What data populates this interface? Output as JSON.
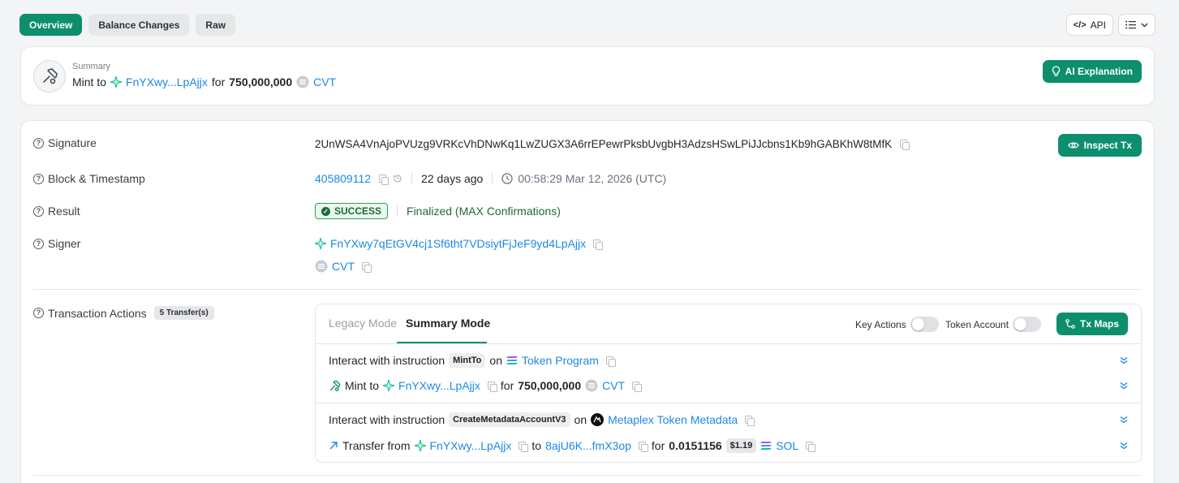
{
  "tabs": [
    {
      "label": "Overview"
    },
    {
      "label": "Balance Changes"
    },
    {
      "label": "Raw"
    }
  ],
  "toolbar": {
    "api_label": "API"
  },
  "summary": {
    "label": "Summary",
    "action": "Mint to",
    "account": "FnYXwy...LpAjjx",
    "for_word": "for",
    "amount": "750,000,000",
    "token": "CVT",
    "ai_button": "AI Explanation"
  },
  "details": {
    "signature": {
      "label": "Signature",
      "value": "2UnWSA4VnAjoPVUzg9VRKcVhDNwKq1LwZUGX3A6rrEPewrPksbUvgbH3AdzsHSwLPiJJcbns1Kb9hGABKhW8tMfK"
    },
    "inspect_button": "Inspect Tx",
    "block": {
      "label": "Block & Timestamp",
      "number": "405809112",
      "age": "22 days ago",
      "timestamp": "00:58:29 Mar 12, 2026 (UTC)"
    },
    "result": {
      "label": "Result",
      "status": "SUCCESS",
      "finality": "Finalized (MAX Confirmations)"
    },
    "signer": {
      "label": "Signer",
      "address": "FnYXwy7qEtGV4cj1Sf6tht7VDsiytFjJeF9yd4LpAjjx",
      "token": "CVT"
    },
    "actions": {
      "label": "Transaction Actions",
      "count_badge": "5 Transfer(s)",
      "legacy_mode": "Legacy Mode",
      "summary_mode": "Summary Mode",
      "key_actions": "Key Actions",
      "token_account": "Token Account",
      "tx_maps": "Tx Maps",
      "items": [
        {
          "prefix": "Interact with instruction",
          "instruction": "MintTo",
          "on": "on",
          "program": "Token Program",
          "sub_action": "Mint to",
          "sub_account": "FnYXwy...LpAjjx",
          "sub_for": "for",
          "sub_amount": "750,000,000",
          "sub_token": "CVT"
        },
        {
          "prefix": "Interact with instruction",
          "instruction": "CreateMetadataAccountV3",
          "on": "on",
          "program": "Metaplex Token Metadata",
          "sub_action": "Transfer from",
          "sub_from": "FnYXwy...LpAjjx",
          "sub_to_word": "to",
          "sub_to": "8ajU6K...fmX3op",
          "sub_for": "for",
          "sub_amount": "0.0151156",
          "sub_price": "$1.19",
          "sub_token": "SOL"
        }
      ]
    }
  }
}
